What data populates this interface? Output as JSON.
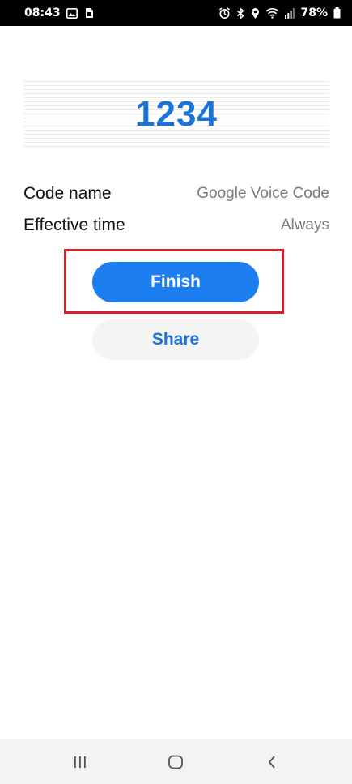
{
  "status_bar": {
    "time": "08:43",
    "battery_percent": "78%",
    "icons_left": [
      "gallery-icon",
      "sim-card-icon"
    ],
    "icons_right": [
      "alarm-icon",
      "bluetooth-icon",
      "location-icon",
      "wifi-icon",
      "signal-icon",
      "battery-icon"
    ]
  },
  "code": {
    "value": "1234",
    "color": "#1a73d9"
  },
  "details": [
    {
      "label": "Code name",
      "value": "Google Voice Code"
    },
    {
      "label": "Effective time",
      "value": "Always"
    }
  ],
  "buttons": {
    "finish_label": "Finish",
    "share_label": "Share",
    "finish_color": "#1d7ef0"
  },
  "highlight_color": "#d8202a",
  "nav_bar": {
    "icons": [
      "recent-apps-icon",
      "home-icon",
      "back-icon"
    ]
  }
}
